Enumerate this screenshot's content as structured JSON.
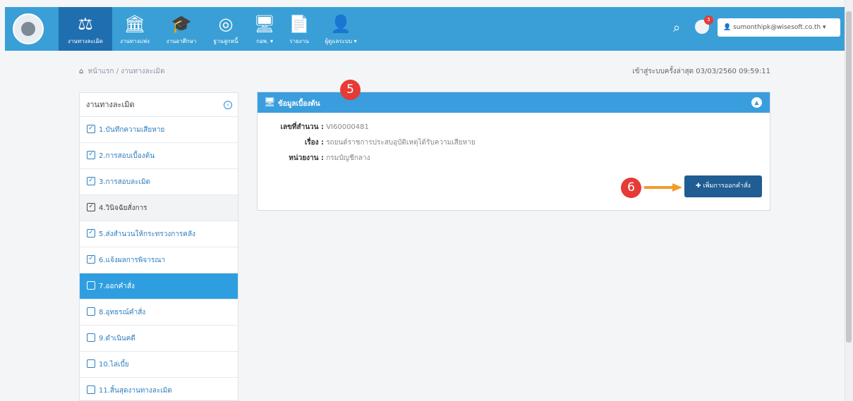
{
  "nav": {
    "items": [
      {
        "label": "งานทางละเมิด",
        "icon": "gavel-icon"
      },
      {
        "label": "งานทางแพ่ง",
        "icon": "bank-icon"
      },
      {
        "label": "งานอาศึกษา",
        "icon": "graduation-cap-icon"
      },
      {
        "label": "ฐานลูกหนี้",
        "icon": "coins-icon"
      },
      {
        "label": "กอพ. ▾",
        "icon": "monitor-icon"
      },
      {
        "label": "รายงาน",
        "icon": "document-icon"
      },
      {
        "label": "ผู้ดูแลระบบ ▾",
        "icon": "user-cog-icon"
      }
    ],
    "notifications_count": "5",
    "user_email": "sumonthipk@wisesoft.co.th ▾"
  },
  "breadcrumb": {
    "home": "หน้าแรก",
    "separator": "/",
    "current": "งานทางละเมิด"
  },
  "last_login": "เข้าสู่ระบบครั้งล่าสุด 03/03/2560 09:59:11",
  "sidebar": {
    "title": "งานทางละเมิด",
    "items": [
      {
        "label": "1.บันทึกความเสียหาย",
        "checked": true
      },
      {
        "label": "2.การสอบเบื้องต้น",
        "checked": true
      },
      {
        "label": "3.การสอบละเมิด",
        "checked": true
      },
      {
        "label": "4.วินิจฉัยสั่งการ",
        "checked": true
      },
      {
        "label": "5.ส่งสำนวนให้กระทรวงการคลัง",
        "checked": true
      },
      {
        "label": "6.แจ้งผลการพิจารณา",
        "checked": true
      },
      {
        "label": "7.ออกคำสั่ง",
        "checked": false
      },
      {
        "label": "8.อุทธรณ์คำสั่ง",
        "checked": false
      },
      {
        "label": "9.ดำเนินคดี",
        "checked": false
      },
      {
        "label": "10.ไล่เบี้ย",
        "checked": false
      },
      {
        "label": "11.สิ้นสุดงานทางละเมิด",
        "checked": false
      }
    ]
  },
  "panel": {
    "title": "ข้อมูลเบื้องต้น",
    "fields": [
      {
        "label": "เลขที่สำนวน :",
        "value": "VI60000481"
      },
      {
        "label": "เรื่อง :",
        "value": "รถยนต์ราชการประสบอุบัติเหตุได้รับความเสียหาย"
      },
      {
        "label": "หน่วยงาน :",
        "value": "กรมบัญชีกลาง"
      }
    ],
    "add_button": "เพิ่มการออกคำสั่ง"
  },
  "annotations": {
    "step5": "5",
    "step6": "6"
  },
  "colors": {
    "nav": "#3a9fd6",
    "nav_active": "#1f6fb0",
    "sidebar_active": "#2f9ee0",
    "button": "#1f5d92",
    "marker": "#e53a36",
    "arrow": "#f39c28"
  }
}
